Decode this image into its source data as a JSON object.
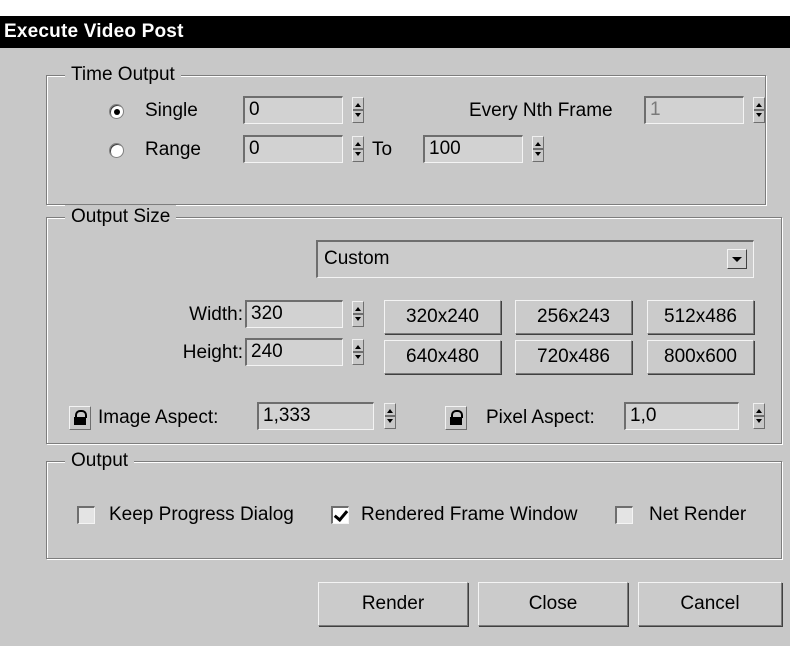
{
  "window": {
    "title": "Execute Video Post"
  },
  "time_output": {
    "legend": "Time Output",
    "single_label": "Single",
    "single_selected": true,
    "single_value": "0",
    "range_label": "Range",
    "range_selected": false,
    "range_from": "0",
    "to_label": "To",
    "range_to": "100",
    "every_nth_label": "Every Nth Frame",
    "every_nth_value": "1"
  },
  "output_size": {
    "legend": "Output Size",
    "preset": "Custom",
    "width_label": "Width:",
    "width_value": "320",
    "height_label": "Height:",
    "height_value": "240",
    "presets": [
      "320x240",
      "256x243",
      "512x486",
      "640x480",
      "720x486",
      "800x600"
    ],
    "image_aspect_label": "Image Aspect:",
    "image_aspect_value": "1,333",
    "pixel_aspect_label": "Pixel Aspect:",
    "pixel_aspect_value": "1,0"
  },
  "output": {
    "legend": "Output",
    "keep_progress_label": "Keep Progress Dialog",
    "keep_progress_checked": false,
    "rendered_frame_label": "Rendered Frame Window",
    "rendered_frame_checked": true,
    "net_render_label": "Net Render",
    "net_render_checked": false
  },
  "buttons": {
    "render": "Render",
    "close": "Close",
    "cancel": "Cancel"
  },
  "icons": {
    "lock": "lock-icon",
    "spinner": "spinner-arrows-icon",
    "dropdown": "chevron-down-icon"
  }
}
